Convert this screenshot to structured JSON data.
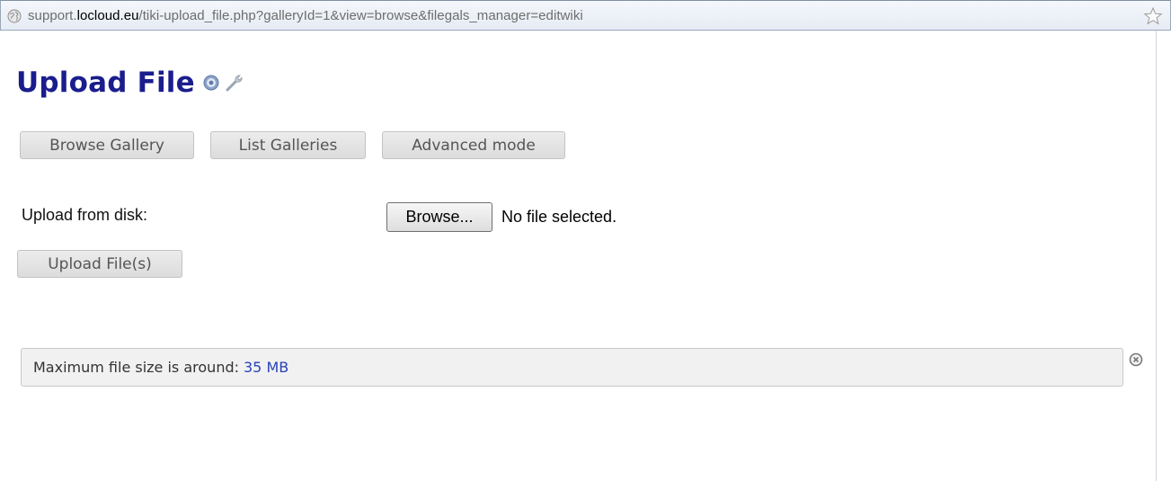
{
  "addressbar": {
    "url_prefix": "support.",
    "url_domain": "locloud.eu",
    "url_path": "/tiki-upload_file.php?galleryId=1&view=browse&filegals_manager=editwiki"
  },
  "page": {
    "title": "Upload File"
  },
  "nav_buttons": {
    "browse_gallery": "Browse Gallery",
    "list_galleries": "List Galleries",
    "advanced_mode": "Advanced mode"
  },
  "upload_form": {
    "label": "Upload from disk:",
    "browse_label": "Browse...",
    "file_status": "No file selected.",
    "submit_label": "Upload File(s)"
  },
  "info": {
    "text": "Maximum file size is around:",
    "size": "35 MB"
  },
  "colors": {
    "title": "#1a1d8c",
    "link": "#2a44b8"
  },
  "icons": [
    "globe-icon",
    "bookmark-star-icon",
    "help-icon",
    "wrench-icon",
    "close-icon"
  ]
}
